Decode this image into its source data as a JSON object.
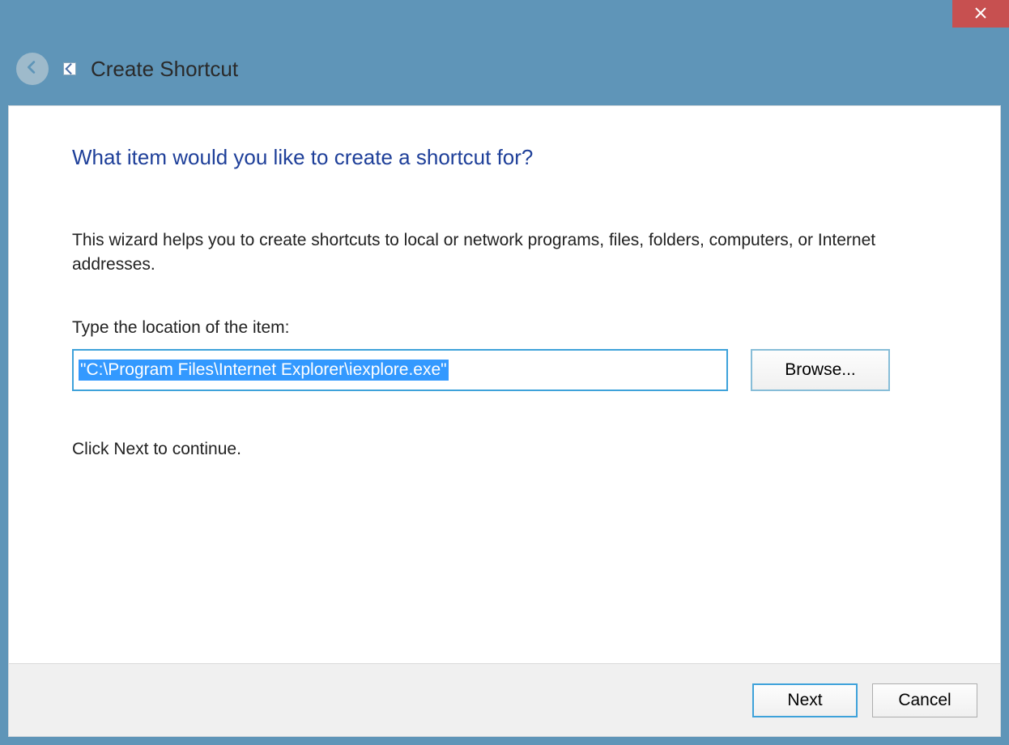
{
  "window": {
    "title": "Create Shortcut"
  },
  "main": {
    "heading": "What item would you like to create a shortcut for?",
    "description": "This wizard helps you to create shortcuts to local or network programs, files, folders, computers, or Internet addresses.",
    "location_label": "Type the location of the item:",
    "location_value": "\"C:\\Program Files\\Internet Explorer\\iexplore.exe\"",
    "browse_label": "Browse...",
    "continue_text": "Click Next to continue."
  },
  "footer": {
    "next_label": "Next",
    "cancel_label": "Cancel"
  }
}
